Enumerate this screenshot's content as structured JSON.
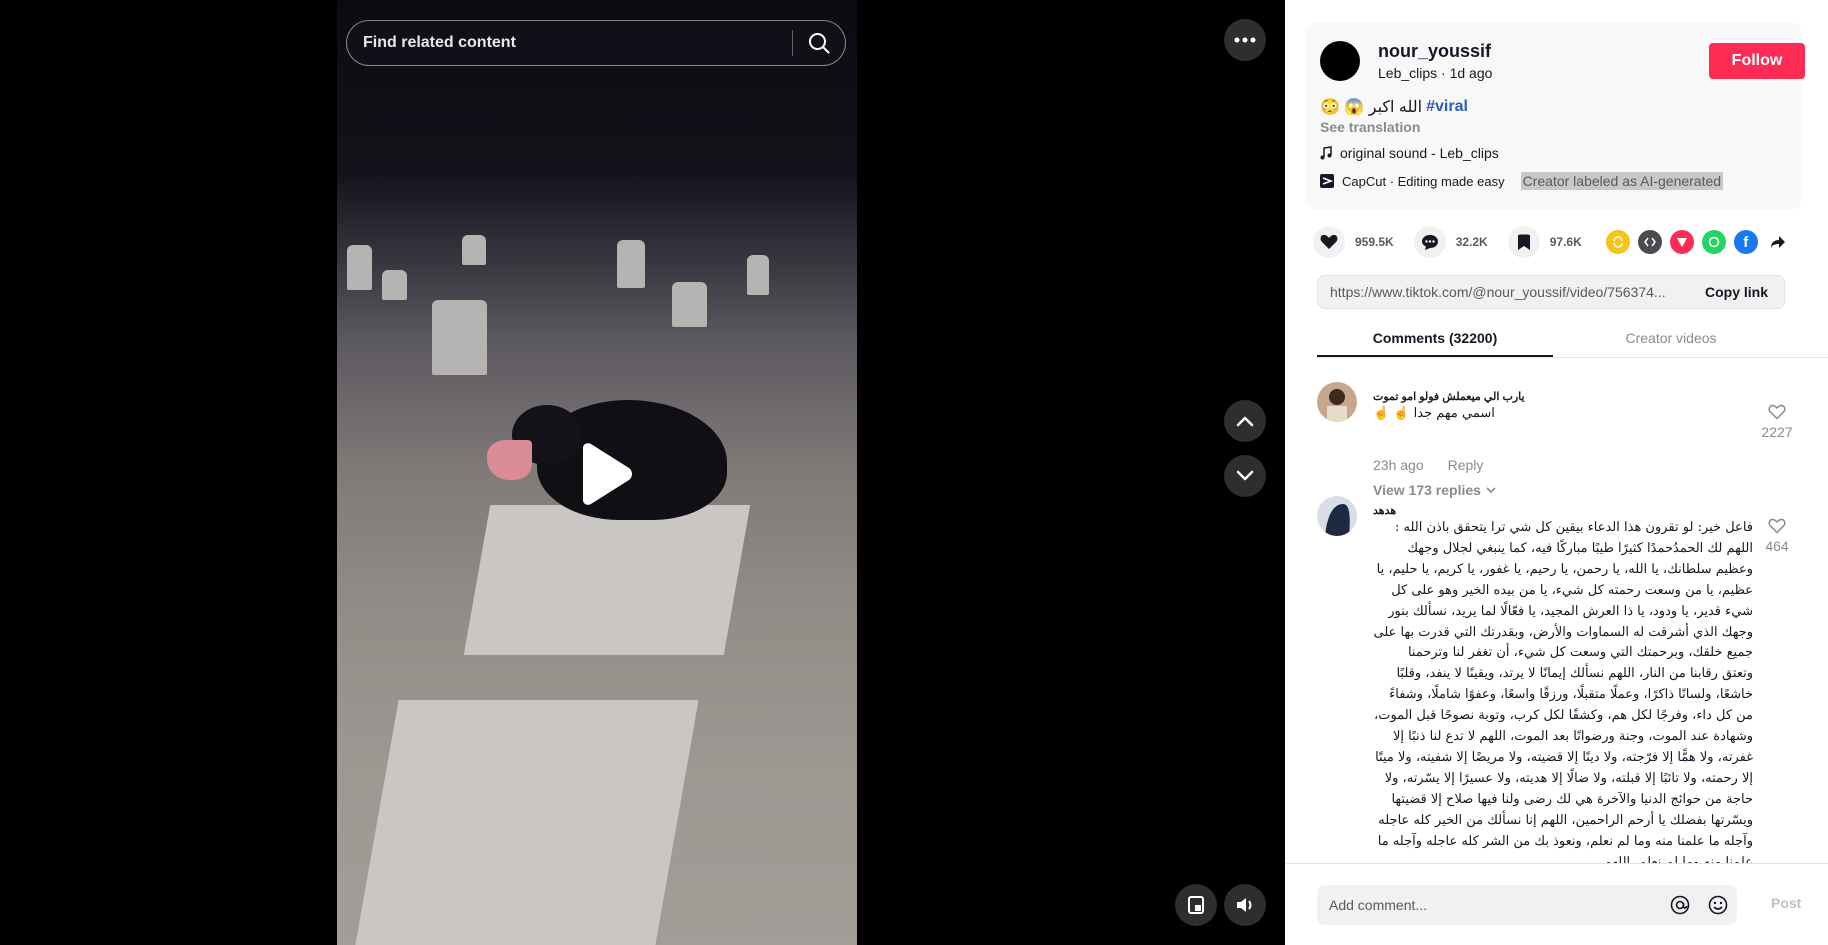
{
  "search": {
    "placeholder": "Find related content"
  },
  "creator": {
    "username": "nour_youssif",
    "subline": "Leb_clips · 1d ago",
    "follow_label": "Follow"
  },
  "caption": {
    "text": "الله اكبر 😱 😳",
    "hashtag": "#viral",
    "see_translation": "See translation"
  },
  "music": {
    "label": "original sound - Leb_clips"
  },
  "capcut": {
    "label": "CapCut · Editing made easy",
    "ai_label": "Creator labeled as AI-generated"
  },
  "stats": {
    "likes": "959.5K",
    "comments": "32.2K",
    "saves": "97.6K"
  },
  "share_colors": [
    "#f5c518",
    "#4b4b52",
    "#fe2c55",
    "#25d366",
    "#1877f2"
  ],
  "link": {
    "url": "https://www.tiktok.com/@nour_youssif/video/756374...",
    "copy_label": "Copy link"
  },
  "tabs": {
    "comments": "Comments (32200)",
    "creator_videos": "Creator videos"
  },
  "comments": [
    {
      "name": "يارب الي ميعملش فولو امو تموت",
      "text": "اسمي مهم جدا ☝️ ☝️",
      "time": "23h ago",
      "reply": "Reply",
      "likes": "2227",
      "view_replies": "View 173 replies"
    },
    {
      "name": "هدهد",
      "text": "فاعل خير: لو تقرون هذا الدعاء بيقين كل شي ترا يتحقق باذن الله : اللهم لك الحمدُحمدًا كثيرًا طيبًا مباركًا فيه، كما ينبغي لجلال وجهك وعظيم سلطانك، يا الله، يا رحمن، يا رحيم، يا غفور، يا كريم، يا حليم، يا عظيم، يا من وسعت رحمته كل شيء، يا من بيده الخير وهو على كل شيء قدير، يا ودود، يا ذا العرش المجيد، يا فعّالًا لما يريد، نسألك بنور وجهك الذي أشرقت له السماوات والأرض، وبقدرتك التي قدرت بها على جميع خلقك، وبرحمتك التي وسعت كل شيء، أن تغفر لنا وترحمنا وتعتق رقابنا من النار، اللهم نسألك إيمانًا لا يرتد، ويقينًا لا ينفد، وقلبًا خاشعًا، ولسانًا ذاكرًا، وعملًا متقبلًا، ورزقًا واسعًا، وعفوًا شاملًا، وشفاءً من كل داء، وفرجًا لكل هم، وكشفًا لكل كرب، وتوبة نصوحًا قبل الموت، وشهادة عند الموت، وجنة ورضوانًا بعد الموت، اللهم لا تدع لنا ذنبًا إلا غفرته، ولا همًّا إلا فرّجته، ولا دينًا إلا قضيته، ولا مريضًا إلا شفيته، ولا ميتًا إلا رحمته، ولا تائبًا إلا قبلته، ولا ضالًا إلا هديته، ولا عسيرًا إلا يسّرته، ولا حاجة من حوائج الدنيا والآخرة هي لك رضى ولنا فيها صلاح إلا قضيتها ويسّرتها بفضلك يا أرحم الراحمين، اللهم إنا نسألك من الخير كله عاجله وآجله ما علمنا منه وما لم نعلم، ونعوذ بك من الشر كله عاجله وآجله ما علمنا منه وما لم نعلم، اللهم",
      "likes": "464"
    }
  ],
  "comment_input": {
    "placeholder": "Add comment...",
    "post_label": "Post"
  }
}
